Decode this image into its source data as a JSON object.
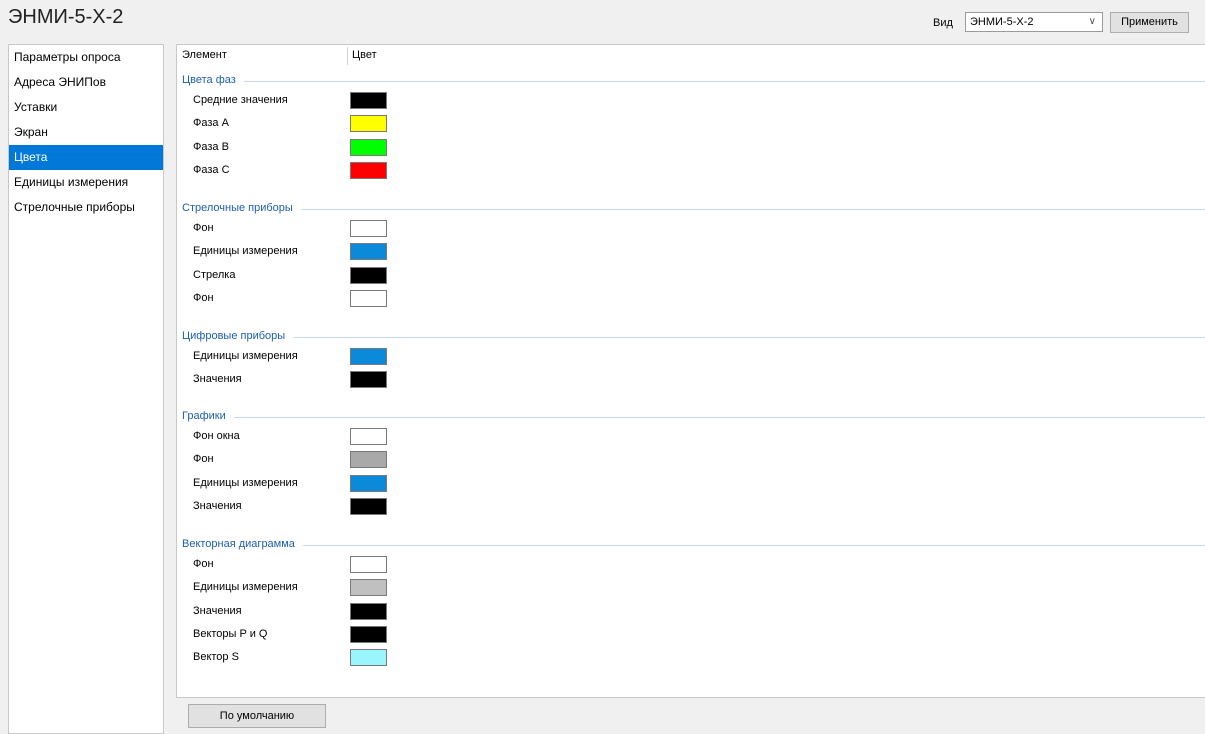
{
  "window": {
    "title": "ЭНМИ-5-X-2",
    "view_label": "Вид",
    "view_value": "ЭНМИ-5-X-2",
    "apply_label": "Применить",
    "default_label": "По умолчанию"
  },
  "sidebar": {
    "items": [
      {
        "label": "Параметры опроса",
        "active": false
      },
      {
        "label": "Адреса ЭНИПов",
        "active": false
      },
      {
        "label": "Уставки",
        "active": false
      },
      {
        "label": "Экран",
        "active": false
      },
      {
        "label": "Цвета",
        "active": true
      },
      {
        "label": "Единицы измерения",
        "active": false
      },
      {
        "label": "Стрелочные приборы",
        "active": false
      }
    ]
  },
  "table": {
    "col_element": "Элемент",
    "col_color": "Цвет"
  },
  "groups": [
    {
      "header": "Цвета фаз",
      "rows": [
        {
          "label": "Средние значения",
          "color": "#000000"
        },
        {
          "label": "Фаза А",
          "color": "#ffff00"
        },
        {
          "label": "Фаза В",
          "color": "#00ff00"
        },
        {
          "label": "Фаза С",
          "color": "#ff0000"
        }
      ]
    },
    {
      "header": "Стрелочные приборы",
      "rows": [
        {
          "label": "Фон",
          "color": "#ffffff"
        },
        {
          "label": "Единицы измерения",
          "color": "#0a8ad8"
        },
        {
          "label": "Стрелка",
          "color": "#000000"
        },
        {
          "label": "Фон",
          "color": "#ffffff"
        }
      ]
    },
    {
      "header": "Цифровые приборы",
      "rows": [
        {
          "label": "Единицы измерения",
          "color": "#0a8ad8"
        },
        {
          "label": "Значения",
          "color": "#000000"
        }
      ]
    },
    {
      "header": "Графики",
      "rows": [
        {
          "label": "Фон окна",
          "color": "#ffffff"
        },
        {
          "label": "Фон",
          "color": "#a9a9a9"
        },
        {
          "label": "Единицы измерения",
          "color": "#0a8ad8"
        },
        {
          "label": "Значения",
          "color": "#000000"
        }
      ]
    },
    {
      "header": "Векторная диаграмма",
      "rows": [
        {
          "label": "Фон",
          "color": "#ffffff"
        },
        {
          "label": "Единицы измерения",
          "color": "#c0c0c0"
        },
        {
          "label": "Значения",
          "color": "#000000"
        },
        {
          "label": "Векторы P и Q",
          "color": "#000000"
        },
        {
          "label": "Вектор S",
          "color": "#99f6ff"
        }
      ]
    }
  ]
}
